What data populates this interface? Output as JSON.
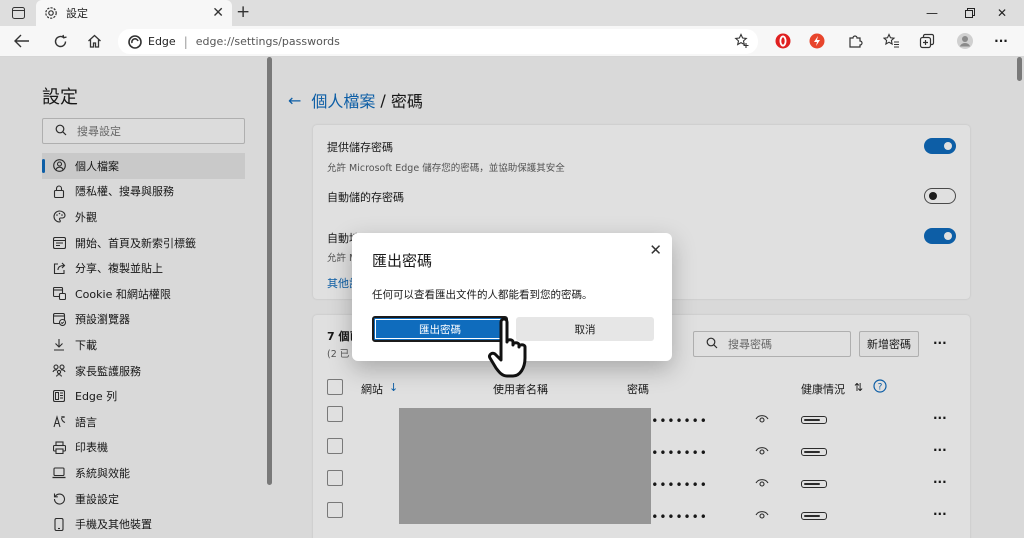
{
  "browser": {
    "tab_title": "設定",
    "url_site": "Edge",
    "url_path": "edge://settings/passwords"
  },
  "sidebar": {
    "title": "設定",
    "search_placeholder": "搜尋設定",
    "items": [
      {
        "label": "個人檔案",
        "icon": "profile-icon",
        "active": true
      },
      {
        "label": "隱私權、搜尋與服務",
        "icon": "lock-icon"
      },
      {
        "label": "外觀",
        "icon": "palette-icon"
      },
      {
        "label": "開始、首頁及新索引標籤",
        "icon": "home-page-icon"
      },
      {
        "label": "分享、複製並貼上",
        "icon": "share-icon"
      },
      {
        "label": "Cookie 和網站權限",
        "icon": "site-permissions-icon"
      },
      {
        "label": "預設瀏覽器",
        "icon": "default-browser-icon"
      },
      {
        "label": "下載",
        "icon": "download-icon"
      },
      {
        "label": "家長監護服務",
        "icon": "family-icon"
      },
      {
        "label": "Edge 列",
        "icon": "edge-bar-icon"
      },
      {
        "label": "語言",
        "icon": "language-icon"
      },
      {
        "label": "印表機",
        "icon": "printer-icon"
      },
      {
        "label": "系統與效能",
        "icon": "laptop-icon"
      },
      {
        "label": "重設設定",
        "icon": "reset-icon"
      },
      {
        "label": "手機及其他裝置",
        "icon": "phone-icon"
      }
    ]
  },
  "breadcrumb": {
    "parent": "個人檔案",
    "current": "密碼"
  },
  "settings": {
    "offer_save_title": "提供儲存密碼",
    "offer_save_desc": "允許 Microsoft Edge 儲存您的密碼，並協助保護其安全",
    "auto_save_title": "自動儲的存密碼",
    "autofill_title": "自動填",
    "autofill_desc": "允許 M",
    "more_link": "其他設"
  },
  "passwords": {
    "count_title": "7 個已",
    "count_sub": "(2 已",
    "search_placeholder": "搜尋密碼",
    "add_button": "新增密碼",
    "more": "···",
    "col_site": "網站",
    "col_username": "使用者名稱",
    "col_password": "密碼",
    "col_health": "健康情況",
    "masked": "••••••••••",
    "row_more": "···"
  },
  "dialog": {
    "title": "匯出密碼",
    "close": "✕",
    "message": "任何可以查看匯出文件的人都能看到您的密碼。",
    "confirm": "匯出密碼",
    "cancel": "取消"
  }
}
